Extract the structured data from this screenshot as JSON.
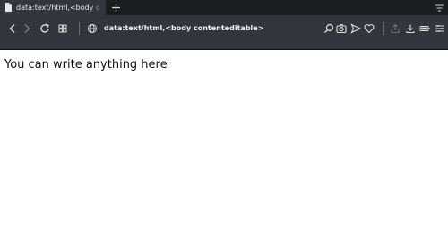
{
  "tab": {
    "title": "data:text/html,<body contenteditable>"
  },
  "toolbar": {
    "url": "data:text/html,<body contenteditable>",
    "icons": [
      "back-icon",
      "forward-icon",
      "reload-icon",
      "tabs-grid-icon",
      "globe-icon",
      "zoom-icon",
      "camera-icon",
      "send-icon",
      "heart-icon",
      "share-icon",
      "download-icon",
      "battery-icon",
      "menu-icon"
    ]
  },
  "page": {
    "body_text": "You can write anything here"
  },
  "colors": {
    "tabbar_bg": "#1c1d21",
    "toolbar_bg": "#33353c",
    "content_bg": "#ffffff"
  }
}
